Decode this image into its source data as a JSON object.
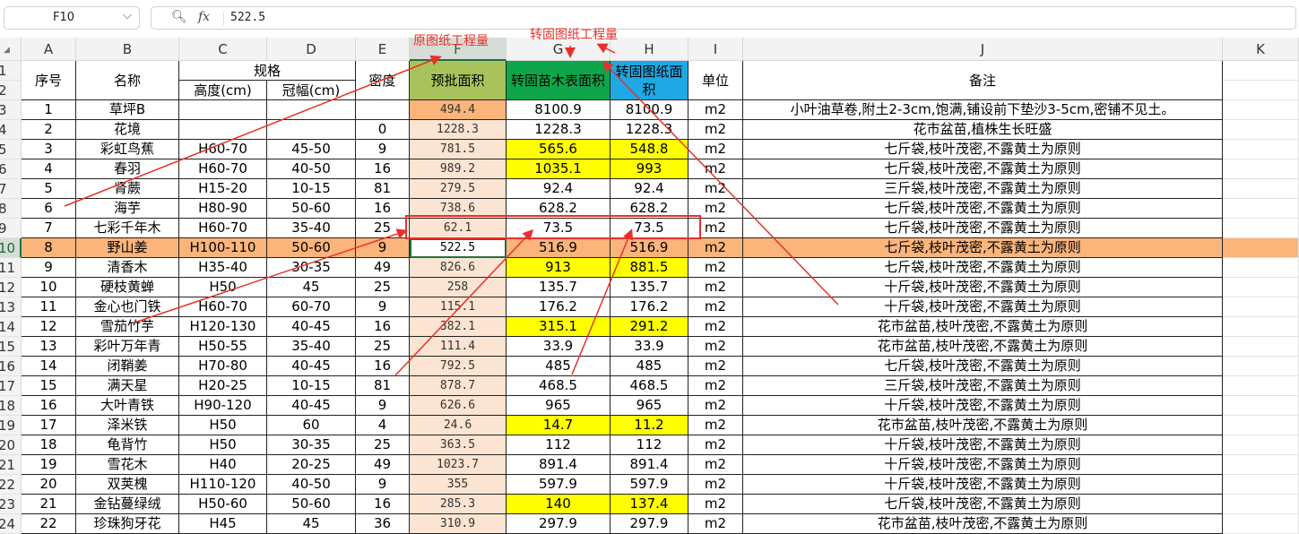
{
  "namebox": {
    "ref": "F10",
    "dropdown_icon": "chevron-down-icon"
  },
  "formula": {
    "zoom_icon": "magnifier-icon",
    "fx_label": "fx",
    "value": "522.5"
  },
  "corner_label": "◢",
  "columns": [
    "A",
    "B",
    "C",
    "D",
    "E",
    "F",
    "G",
    "H",
    "I",
    "J",
    "K"
  ],
  "header": {
    "seq": "序号",
    "name": "名称",
    "spec": "规格",
    "height": "高度(cm)",
    "crown": "冠幅(cm)",
    "density": "密度",
    "approved_area": "预批面积",
    "surface_area": "转固苗木表面积",
    "drawing_area": "转固图纸面积",
    "unit": "单位",
    "remark": "备注"
  },
  "annotations": {
    "original": "原图纸工程量",
    "converted": "转固图纸工程量"
  },
  "colors": {
    "header_f": "#a9c35c",
    "header_g": "#0fa64b",
    "header_h": "#1ea8e4",
    "col_f": "#fce4d2",
    "yellow": "#ffff00",
    "selected_row": "#fbb47a",
    "red": "#e8302a",
    "active_green": "#1e7145"
  },
  "rows": [
    {
      "r": "3",
      "seq": "1",
      "name": "草坪B",
      "height": "",
      "crown": "",
      "density": "",
      "f": "494.4",
      "g": "8100.9",
      "h": "8100.9",
      "unit": "m2",
      "remark": "小叶油草卷,附土2-3cm,饱满,铺设前下垫沙3-5cm,密铺不见土。",
      "hl": false
    },
    {
      "r": "4",
      "seq": "2",
      "name": "花境",
      "height": "",
      "crown": "",
      "density": "0",
      "f": "1228.3",
      "g": "1228.3",
      "h": "1228.3",
      "unit": "m2",
      "remark": "花市盆苗,植株生长旺盛",
      "hl": false
    },
    {
      "r": "5",
      "seq": "3",
      "name": "彩虹鸟蕉",
      "height": "H60-70",
      "crown": "45-50",
      "density": "9",
      "f": "781.5",
      "g": "565.6",
      "h": "548.8",
      "unit": "m2",
      "remark": "七斤袋,枝叶茂密,不露黄土为原则",
      "hl": true
    },
    {
      "r": "6",
      "seq": "4",
      "name": "春羽",
      "height": "H60-70",
      "crown": "40-50",
      "density": "16",
      "f": "989.2",
      "g": "1035.1",
      "h": "993",
      "unit": "m2",
      "remark": "七斤袋,枝叶茂密,不露黄土为原则",
      "hl": true
    },
    {
      "r": "7",
      "seq": "5",
      "name": "肾蕨",
      "height": "H15-20",
      "crown": "10-15",
      "density": "81",
      "f": "279.5",
      "g": "92.4",
      "h": "92.4",
      "unit": "m2",
      "remark": "三斤袋,枝叶茂密,不露黄土为原则",
      "hl": false
    },
    {
      "r": "8",
      "seq": "6",
      "name": "海芋",
      "height": "H80-90",
      "crown": "50-60",
      "density": "16",
      "f": "738.6",
      "g": "628.2",
      "h": "628.2",
      "unit": "m2",
      "remark": "七斤袋,枝叶茂密,不露黄土为原则",
      "hl": false
    },
    {
      "r": "9",
      "seq": "7",
      "name": "七彩千年木",
      "height": "H60-70",
      "crown": "35-40",
      "density": "25",
      "f": "62.1",
      "g": "73.5",
      "h": "73.5",
      "unit": "m2",
      "remark": "七斤袋,枝叶茂密,不露黄土为原则",
      "hl": false
    },
    {
      "r": "10",
      "seq": "8",
      "name": "野山姜",
      "height": "H100-110",
      "crown": "50-60",
      "density": "9",
      "f": "522.5",
      "g": "516.9",
      "h": "516.9",
      "unit": "m2",
      "remark": "七斤袋,枝叶茂密,不露黄土为原则",
      "hl": false,
      "sel": true
    },
    {
      "r": "11",
      "seq": "9",
      "name": "清香木",
      "height": "H35-40",
      "crown": "30-35",
      "density": "49",
      "f": "826.6",
      "g": "913",
      "h": "881.5",
      "unit": "m2",
      "remark": "七斤袋,枝叶茂密,不露黄土为原则",
      "hl": true
    },
    {
      "r": "12",
      "seq": "10",
      "name": "硬枝黄蝉",
      "height": "H50",
      "crown": "45",
      "density": "25",
      "f": "258",
      "g": "135.7",
      "h": "135.7",
      "unit": "m2",
      "remark": "十斤袋,枝叶茂密,不露黄土为原则",
      "hl": false
    },
    {
      "r": "13",
      "seq": "11",
      "name": "金心也门铁",
      "height": "H60-70",
      "crown": "60-70",
      "density": "9",
      "f": "115.1",
      "g": "176.2",
      "h": "176.2",
      "unit": "m2",
      "remark": "十斤袋,枝叶茂密,不露黄土为原则",
      "hl": false
    },
    {
      "r": "14",
      "seq": "12",
      "name": "雪茄竹芋",
      "height": "H120-130",
      "crown": "40-45",
      "density": "16",
      "f": "382.1",
      "g": "315.1",
      "h": "291.2",
      "unit": "m2",
      "remark": "花市盆苗,枝叶茂密,不露黄土为原则",
      "hl": true
    },
    {
      "r": "15",
      "seq": "13",
      "name": "彩叶万年青",
      "height": "H50-55",
      "crown": "35-40",
      "density": "25",
      "f": "111.4",
      "g": "33.9",
      "h": "33.9",
      "unit": "m2",
      "remark": "花市盆苗,枝叶茂密,不露黄土为原则",
      "hl": false
    },
    {
      "r": "16",
      "seq": "14",
      "name": "闭鞘姜",
      "height": "H70-80",
      "crown": "40-45",
      "density": "16",
      "f": "792.5",
      "g": "485",
      "h": "485",
      "unit": "m2",
      "remark": "七斤袋,枝叶茂密,不露黄土为原则",
      "hl": false
    },
    {
      "r": "17",
      "seq": "15",
      "name": "满天星",
      "height": "H20-25",
      "crown": "10-15",
      "density": "81",
      "f": "878.7",
      "g": "468.5",
      "h": "468.5",
      "unit": "m2",
      "remark": "三斤袋,枝叶茂密,不露黄土为原则",
      "hl": false
    },
    {
      "r": "18",
      "seq": "16",
      "name": "大叶青铁",
      "height": "H90-120",
      "crown": "40-45",
      "density": "9",
      "f": "626.6",
      "g": "965",
      "h": "965",
      "unit": "m2",
      "remark": "十斤袋,枝叶茂密,不露黄土为原则",
      "hl": false
    },
    {
      "r": "19",
      "seq": "17",
      "name": "泽米铁",
      "height": "H50",
      "crown": "60",
      "density": "4",
      "f": "24.6",
      "g": "14.7",
      "h": "11.2",
      "unit": "m2",
      "remark": "花市盆苗,枝叶茂密,不露黄土为原则",
      "hl": true
    },
    {
      "r": "20",
      "seq": "18",
      "name": "龟背竹",
      "height": "H50",
      "crown": "30-35",
      "density": "25",
      "f": "363.5",
      "g": "112",
      "h": "112",
      "unit": "m2",
      "remark": "十斤袋,枝叶茂密,不露黄土为原则",
      "hl": false
    },
    {
      "r": "21",
      "seq": "19",
      "name": "雪花木",
      "height": "H40",
      "crown": "20-25",
      "density": "49",
      "f": "1023.7",
      "g": "891.4",
      "h": "891.4",
      "unit": "m2",
      "remark": "十斤袋,枝叶茂密,不露黄土为原则",
      "hl": false
    },
    {
      "r": "22",
      "seq": "20",
      "name": "双荚槐",
      "height": "H110-120",
      "crown": "40-50",
      "density": "9",
      "f": "355",
      "g": "597.9",
      "h": "597.9",
      "unit": "m2",
      "remark": "十斤袋,枝叶茂密,不露黄土为原则",
      "hl": false
    },
    {
      "r": "23",
      "seq": "21",
      "name": "金钻蔓绿绒",
      "height": "H50-60",
      "crown": "50-60",
      "density": "16",
      "f": "285.3",
      "g": "140",
      "h": "137.4",
      "unit": "m2",
      "remark": "七斤袋,枝叶茂密,不露黄土为原则",
      "hl": true
    },
    {
      "r": "24",
      "seq": "22",
      "name": "珍珠狗牙花",
      "height": "H45",
      "crown": "45",
      "density": "36",
      "f": "310.9",
      "g": "297.9",
      "h": "297.9",
      "unit": "m2",
      "remark": "花市盆苗,枝叶茂密,不露黄土为原则",
      "hl": false
    }
  ]
}
